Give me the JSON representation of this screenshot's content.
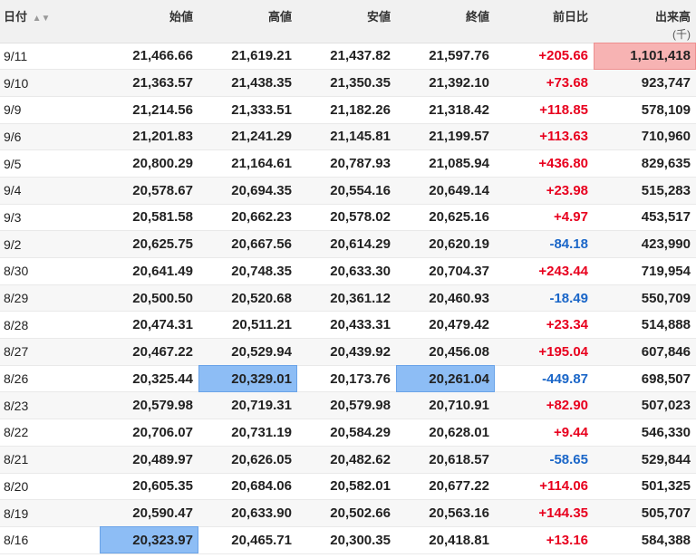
{
  "header": {
    "date": "日付",
    "sort_icon": "▲▼",
    "open": "始値",
    "high": "高値",
    "low": "安値",
    "close": "終値",
    "change": "前日比",
    "volume": "出来高",
    "volume_unit": "(千)"
  },
  "colors": {
    "positive": "#e8001e",
    "negative": "#1a66c8",
    "highlight_blue": "#8dbdf5",
    "highlight_red": "#f7b3b3"
  },
  "rows": [
    {
      "date": "9/11",
      "open": "21,466.66",
      "high": "21,619.21",
      "low": "21,437.82",
      "close": "21,597.76",
      "change": "+205.66",
      "volume": "1,101,418"
    },
    {
      "date": "9/10",
      "open": "21,363.57",
      "high": "21,438.35",
      "low": "21,350.35",
      "close": "21,392.10",
      "change": "+73.68",
      "volume": "923,747"
    },
    {
      "date": "9/9",
      "open": "21,214.56",
      "high": "21,333.51",
      "low": "21,182.26",
      "close": "21,318.42",
      "change": "+118.85",
      "volume": "578,109"
    },
    {
      "date": "9/6",
      "open": "21,201.83",
      "high": "21,241.29",
      "low": "21,145.81",
      "close": "21,199.57",
      "change": "+113.63",
      "volume": "710,960"
    },
    {
      "date": "9/5",
      "open": "20,800.29",
      "high": "21,164.61",
      "low": "20,787.93",
      "close": "21,085.94",
      "change": "+436.80",
      "volume": "829,635"
    },
    {
      "date": "9/4",
      "open": "20,578.67",
      "high": "20,694.35",
      "low": "20,554.16",
      "close": "20,649.14",
      "change": "+23.98",
      "volume": "515,283"
    },
    {
      "date": "9/3",
      "open": "20,581.58",
      "high": "20,662.23",
      "low": "20,578.02",
      "close": "20,625.16",
      "change": "+4.97",
      "volume": "453,517"
    },
    {
      "date": "9/2",
      "open": "20,625.75",
      "high": "20,667.56",
      "low": "20,614.29",
      "close": "20,620.19",
      "change": "-84.18",
      "volume": "423,990"
    },
    {
      "date": "8/30",
      "open": "20,641.49",
      "high": "20,748.35",
      "low": "20,633.30",
      "close": "20,704.37",
      "change": "+243.44",
      "volume": "719,954"
    },
    {
      "date": "8/29",
      "open": "20,500.50",
      "high": "20,520.68",
      "low": "20,361.12",
      "close": "20,460.93",
      "change": "-18.49",
      "volume": "550,709"
    },
    {
      "date": "8/28",
      "open": "20,474.31",
      "high": "20,511.21",
      "low": "20,433.31",
      "close": "20,479.42",
      "change": "+23.34",
      "volume": "514,888"
    },
    {
      "date": "8/27",
      "open": "20,467.22",
      "high": "20,529.94",
      "low": "20,439.92",
      "close": "20,456.08",
      "change": "+195.04",
      "volume": "607,846"
    },
    {
      "date": "8/26",
      "open": "20,325.44",
      "high": "20,329.01",
      "low": "20,173.76",
      "close": "20,261.04",
      "change": "-449.87",
      "volume": "698,507"
    },
    {
      "date": "8/23",
      "open": "20,579.98",
      "high": "20,719.31",
      "low": "20,579.98",
      "close": "20,710.91",
      "change": "+82.90",
      "volume": "507,023"
    },
    {
      "date": "8/22",
      "open": "20,706.07",
      "high": "20,731.19",
      "low": "20,584.29",
      "close": "20,628.01",
      "change": "+9.44",
      "volume": "546,330"
    },
    {
      "date": "8/21",
      "open": "20,489.97",
      "high": "20,626.05",
      "low": "20,482.62",
      "close": "20,618.57",
      "change": "-58.65",
      "volume": "529,844"
    },
    {
      "date": "8/20",
      "open": "20,605.35",
      "high": "20,684.06",
      "low": "20,582.01",
      "close": "20,677.22",
      "change": "+114.06",
      "volume": "501,325"
    },
    {
      "date": "8/19",
      "open": "20,590.47",
      "high": "20,633.90",
      "low": "20,502.66",
      "close": "20,563.16",
      "change": "+144.35",
      "volume": "505,707"
    },
    {
      "date": "8/16",
      "open": "20,323.97",
      "high": "20,465.71",
      "low": "20,300.35",
      "close": "20,418.81",
      "change": "+13.16",
      "volume": "584,388"
    }
  ]
}
